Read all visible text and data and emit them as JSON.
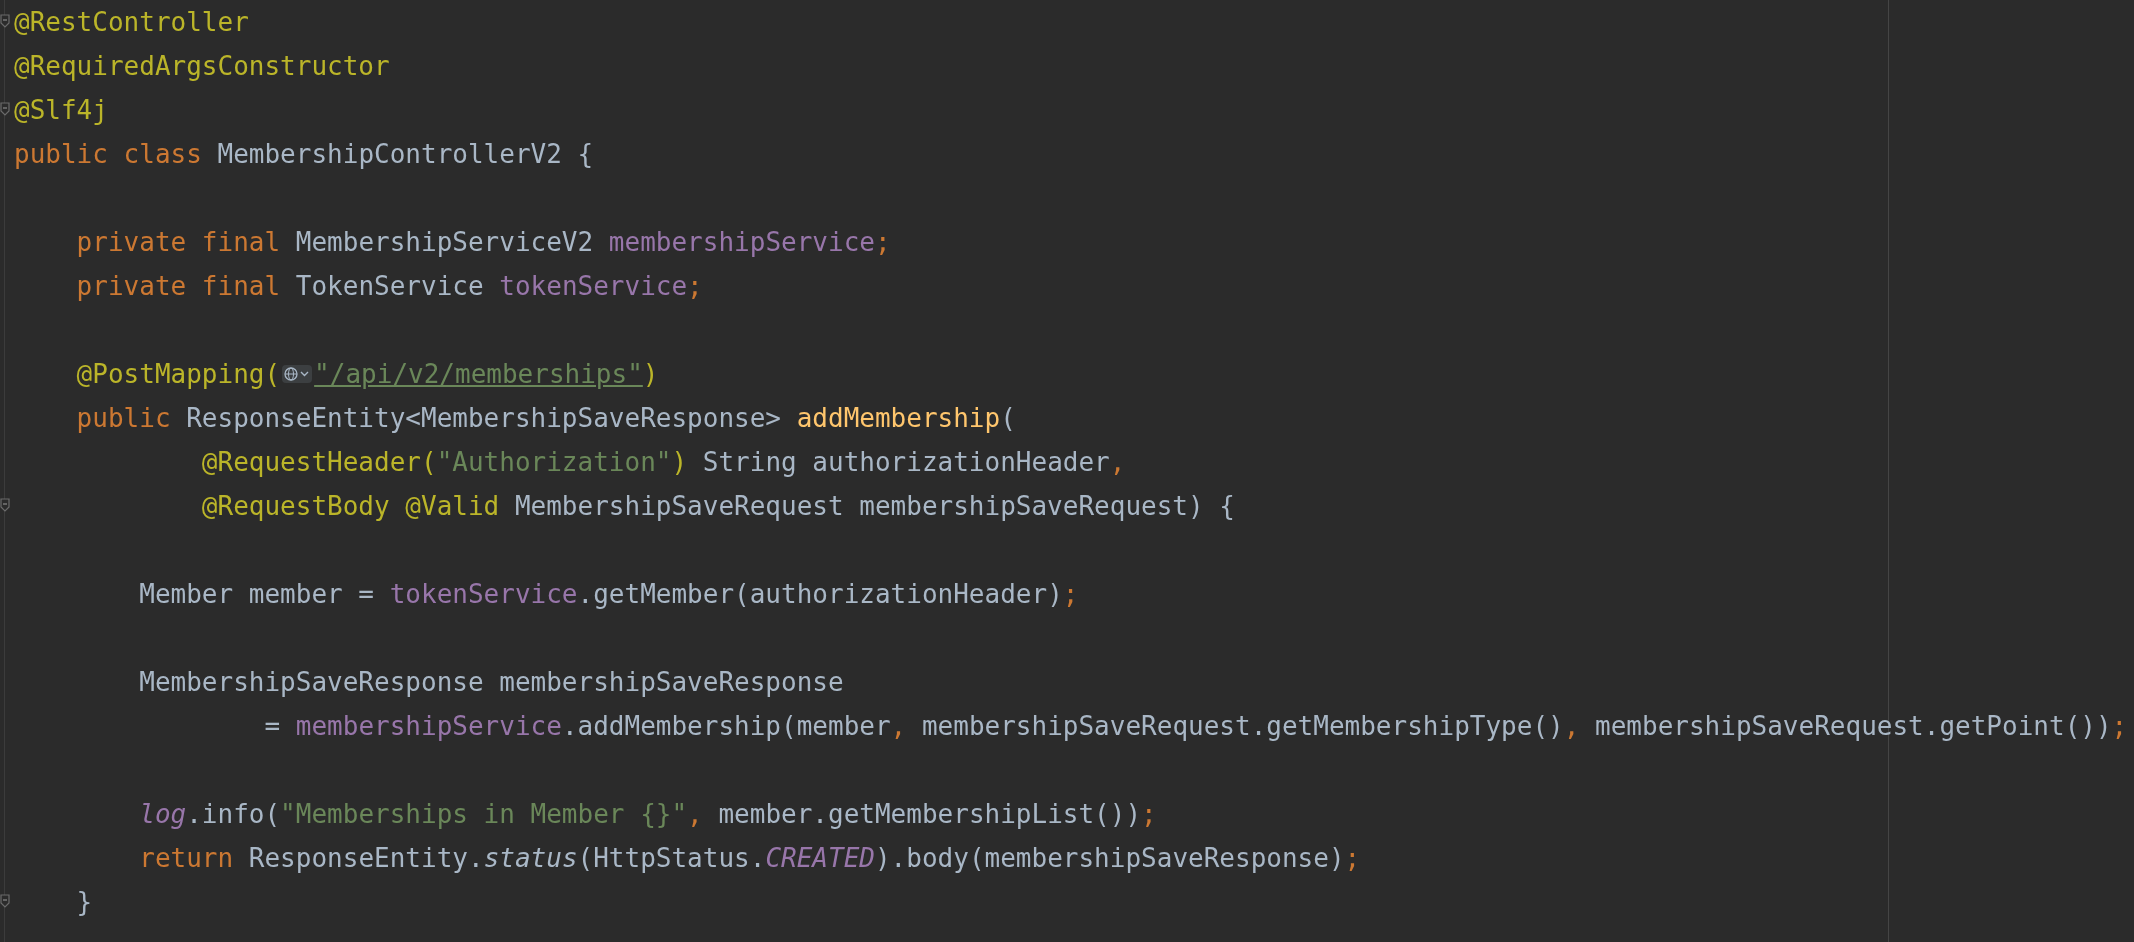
{
  "editor": {
    "lines": [
      {
        "kind": "code",
        "fold": true,
        "tokens": [
          {
            "text": "@RestController",
            "kind": "annotation"
          }
        ]
      },
      {
        "kind": "code",
        "tokens": [
          {
            "text": "@RequiredArgsConstructor",
            "kind": "annotation"
          }
        ]
      },
      {
        "kind": "code",
        "fold": true,
        "tokens": [
          {
            "text": "@Slf4j",
            "kind": "annotation"
          }
        ]
      },
      {
        "kind": "code",
        "tokens": [
          {
            "text": "public class ",
            "kind": "keyword"
          },
          {
            "text": "MembershipControllerV2 {",
            "kind": "plain"
          }
        ]
      },
      {
        "kind": "blank"
      },
      {
        "kind": "code",
        "tokens": [
          {
            "text": "    private final ",
            "kind": "keyword"
          },
          {
            "text": "MembershipServiceV2 ",
            "kind": "plain"
          },
          {
            "text": "membershipService",
            "kind": "field"
          },
          {
            "text": ";",
            "kind": "punct"
          }
        ]
      },
      {
        "kind": "code",
        "tokens": [
          {
            "text": "    private final ",
            "kind": "keyword"
          },
          {
            "text": "TokenService ",
            "kind": "plain"
          },
          {
            "text": "tokenService",
            "kind": "field"
          },
          {
            "text": ";",
            "kind": "punct"
          }
        ]
      },
      {
        "kind": "blank"
      },
      {
        "kind": "code",
        "tokens": [
          {
            "text": "    @PostMapping(",
            "kind": "annotation"
          },
          {
            "kind": "inlay-icon"
          },
          {
            "text": "\"/api/v2/memberships\"",
            "kind": "url"
          },
          {
            "text": ")",
            "kind": "annotation"
          }
        ]
      },
      {
        "kind": "code",
        "tokens": [
          {
            "text": "    public ",
            "kind": "keyword"
          },
          {
            "text": "ResponseEntity<MembershipSaveResponse> ",
            "kind": "plain"
          },
          {
            "text": "addMembership",
            "kind": "method"
          },
          {
            "text": "(",
            "kind": "plain"
          }
        ]
      },
      {
        "kind": "code",
        "tokens": [
          {
            "text": "            @RequestHeader(",
            "kind": "annotation"
          },
          {
            "text": "\"Authorization\"",
            "kind": "string"
          },
          {
            "text": ") ",
            "kind": "annotation"
          },
          {
            "text": "String authorizationHeader",
            "kind": "plain"
          },
          {
            "text": ",",
            "kind": "punct"
          }
        ]
      },
      {
        "kind": "code",
        "fold": true,
        "tokens": [
          {
            "text": "            @RequestBody @Valid ",
            "kind": "annotation"
          },
          {
            "text": "MembershipSaveRequest membershipSaveRequest) {",
            "kind": "plain"
          }
        ]
      },
      {
        "kind": "blank"
      },
      {
        "kind": "code",
        "tokens": [
          {
            "text": "        Member member = ",
            "kind": "plain"
          },
          {
            "text": "tokenService",
            "kind": "field"
          },
          {
            "text": ".getMember(authorizationHeader)",
            "kind": "plain"
          },
          {
            "text": ";",
            "kind": "punct"
          }
        ]
      },
      {
        "kind": "blank"
      },
      {
        "kind": "code",
        "tokens": [
          {
            "text": "        MembershipSaveResponse membershipSaveResponse",
            "kind": "plain"
          }
        ]
      },
      {
        "kind": "code",
        "tokens": [
          {
            "text": "                = ",
            "kind": "plain"
          },
          {
            "text": "membershipService",
            "kind": "field"
          },
          {
            "text": ".addMembership(member",
            "kind": "plain"
          },
          {
            "text": ", ",
            "kind": "punct"
          },
          {
            "text": "membershipSaveRequest.getMembershipType()",
            "kind": "plain"
          },
          {
            "text": ", ",
            "kind": "punct"
          },
          {
            "text": "membershipSaveRequest.getPoint())",
            "kind": "plain"
          },
          {
            "text": ";",
            "kind": "punct"
          }
        ]
      },
      {
        "kind": "blank"
      },
      {
        "kind": "code",
        "tokens": [
          {
            "text": "        log",
            "kind": "static-field"
          },
          {
            "text": ".info(",
            "kind": "plain"
          },
          {
            "text": "\"Memberships in Member {}\"",
            "kind": "string"
          },
          {
            "text": ", ",
            "kind": "punct"
          },
          {
            "text": "member.getMembershipList())",
            "kind": "plain"
          },
          {
            "text": ";",
            "kind": "punct"
          }
        ]
      },
      {
        "kind": "code",
        "tokens": [
          {
            "text": "        return ",
            "kind": "keyword"
          },
          {
            "text": "ResponseEntity.",
            "kind": "plain"
          },
          {
            "text": "status",
            "kind": "static-method"
          },
          {
            "text": "(HttpStatus.",
            "kind": "plain"
          },
          {
            "text": "CREATED",
            "kind": "static-field"
          },
          {
            "text": ").body(membershipSaveResponse)",
            "kind": "plain"
          },
          {
            "text": ";",
            "kind": "punct"
          }
        ]
      },
      {
        "kind": "code",
        "fold": true,
        "tokens": [
          {
            "text": "    }",
            "kind": "plain"
          }
        ]
      }
    ]
  }
}
